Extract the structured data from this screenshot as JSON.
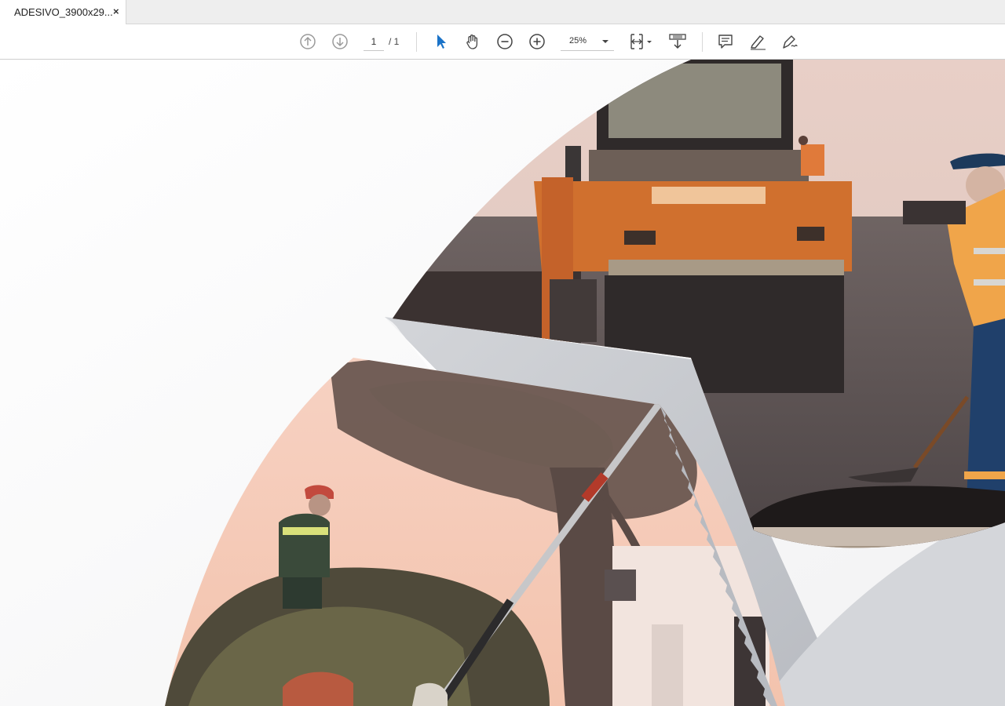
{
  "tab": {
    "title": "ADESIVO_3900x29...",
    "close_label": "×"
  },
  "toolbar": {
    "page_current": "1",
    "page_total": "/ 1",
    "zoom": "25%",
    "icons": [
      "prev-page-icon",
      "next-page-icon",
      "select-cursor-icon",
      "hand-tool-icon",
      "zoom-out-icon",
      "zoom-in-icon",
      "page-fit-icon",
      "download-icon",
      "comment-icon",
      "highlight-icon",
      "draw-icon"
    ]
  },
  "colors": {
    "accent_cursor": "#1a73c8",
    "icon": "#444444",
    "icon_disabled": "#9a9a9a",
    "swoosh_gray": "#c8cacf",
    "photo_tint": "#f4c8b4"
  },
  "document": {
    "content": "photo collage of road paving roller and workers pruning trees"
  }
}
